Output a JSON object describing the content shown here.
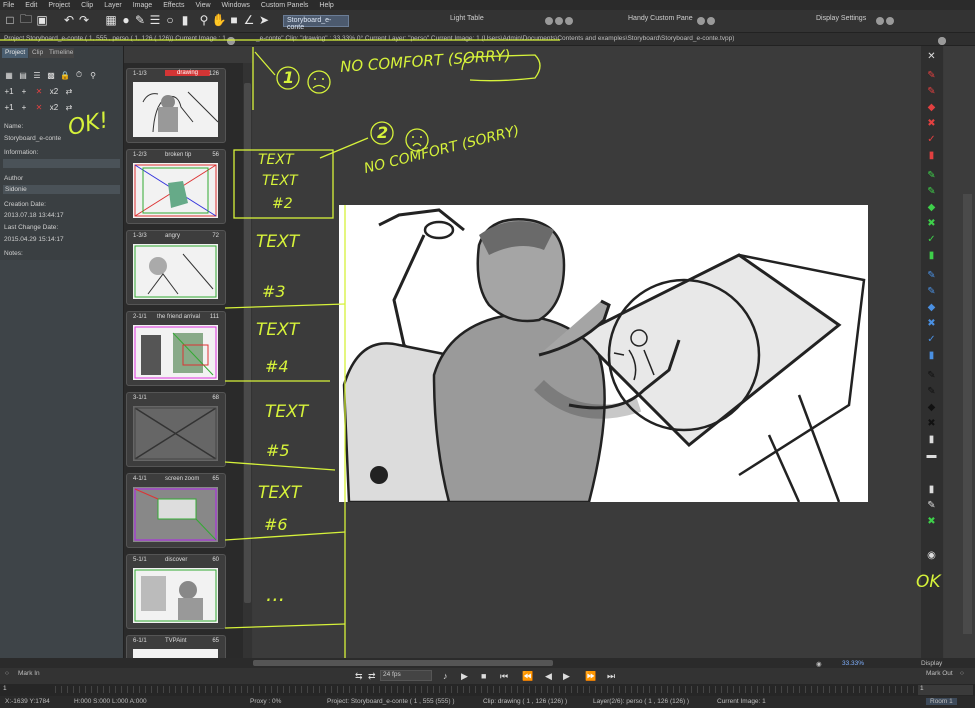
{
  "menu": [
    "File",
    "Edit",
    "Project",
    "Clip",
    "Layer",
    "Image",
    "Effects",
    "View",
    "Windows",
    "Custom Panels",
    "Help"
  ],
  "toolbar": {
    "story_tab": "Storyboard_e-conte",
    "light_table": "Light Table",
    "handy_panel": "Handy Custom Pane",
    "display_settings": "Display Settings"
  },
  "info_strip": {
    "project": "Project Storyboard_e-conte ( 1, 555 , perso ( 1, 126 ( 126)) Current Image : 1",
    "clip": "_e-conte\"  Clip: \"drawing\" : 33.33%   0°  Current Layer: \"perso\"  Current Image: 1  (Users\\Admin\\Documents\\Contents and examples\\Storyboard\\Storyboard_e-conte.tvpp)"
  },
  "left_panel": {
    "tabs": [
      "Project",
      "Clip",
      "Timeline"
    ],
    "name_label": "Name:",
    "name_value": "Storyboard_e-conte",
    "information_label": "Information:",
    "author_label": "Author",
    "author_value": "Sidonie",
    "creation_label": "Creation Date:",
    "creation_value": "2013.07.18 13:44:17",
    "change_label": "Last Change Date:",
    "change_value": "2015.04.29 15:14:17",
    "notes_label": "Notes:"
  },
  "thumbnails": [
    {
      "id": "1-1/3",
      "name": "drawing",
      "frames": "126",
      "selected": true
    },
    {
      "id": "1-2/3",
      "name": "broken tip",
      "frames": "56",
      "selected": false
    },
    {
      "id": "1-3/3",
      "name": "angry",
      "frames": "72",
      "selected": false
    },
    {
      "id": "2-1/1",
      "name": "the friend arrival",
      "frames": "111",
      "selected": false
    },
    {
      "id": "3-1/1",
      "name": "",
      "frames": "68",
      "selected": false
    },
    {
      "id": "4-1/1",
      "name": "screen zoom",
      "frames": "65",
      "selected": false
    },
    {
      "id": "5-1/1",
      "name": "discover",
      "frames": "60",
      "selected": false
    },
    {
      "id": "6-1/1",
      "name": "TVPAint",
      "frames": "65",
      "selected": false
    }
  ],
  "annotations": {
    "num1": "1",
    "num2": "2",
    "no_comfort_1": "NO COMFORT (SORRY)",
    "no_comfort_2": "NO COMFORT (SORRY)",
    "ok_left": "OK!",
    "ok_right": "OK",
    "text2a": "TEXT",
    "text2b": "TEXT",
    "text2c": "#2",
    "text3a": "TEXT",
    "text3b": "#3",
    "text4a": "TEXT",
    "text4b": "#4",
    "text5a": "TEXT",
    "text5b": "#5",
    "text6a": "TEXT",
    "text6b": "#6",
    "dots": "..."
  },
  "bottom": {
    "mark_in": "Mark In",
    "mark_out": "Mark Out",
    "fps": "24 fps",
    "zoom": "33.33%",
    "display": "Display",
    "frame_left": "1",
    "frame_right": "1"
  },
  "status": {
    "coords": "X:-1639  Y:1784",
    "hsl": "H:000 S:000 L:000 A:000",
    "proxy": "Proxy : 0%",
    "project": "Project: Storyboard_e-conte ( 1 , 555  (555) )",
    "clip": "Clip: drawing ( 1 , 126  (126) )",
    "layer": "Layer(2/6): perso ( 1 , 126  (126) )",
    "current": "Current Image: 1",
    "room": "Room 1"
  },
  "colors": {
    "annotation": "#d6f23a",
    "selected_header": "#d43535",
    "storyboard_tab": "#4c5a6e"
  }
}
